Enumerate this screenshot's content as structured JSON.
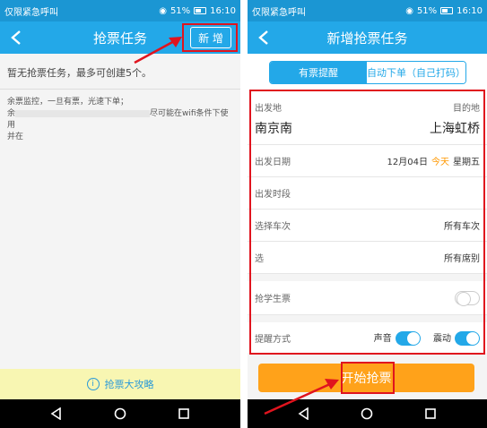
{
  "left": {
    "status": {
      "carrier": "仅限紧急呼叫",
      "battery": "51%",
      "time": "16:10"
    },
    "title": "抢票任务",
    "add_label": "新 增",
    "notice": "暂无抢票任务，最多可创建5个。",
    "monitor_line1": "余票监控，一旦有票，光速下单；",
    "monitor_line2_a": "余",
    "monitor_line2_b": "尽可能在wifi条件下使用",
    "monitor_line3": "并在",
    "guide_icon": "i",
    "guide_label": "抢票大攻略"
  },
  "right": {
    "status": {
      "carrier": "仅限紧急呼叫",
      "battery": "51%",
      "time": "16:10"
    },
    "title": "新增抢票任务",
    "tabs": [
      {
        "label": "有票提醒",
        "active": true
      },
      {
        "label": "自动下单（自己打码）",
        "active": false
      }
    ],
    "from_label": "出发地",
    "to_label": "目的地",
    "from_value": "南京南",
    "to_value": "上海虹桥",
    "date_label": "出发日期",
    "date_value": "12月04日",
    "today_label": "今天",
    "weekday_label": "星期五",
    "time_label": "出发时段",
    "train_label": "选择车次",
    "train_value": "所有车次",
    "seat_label": "选",
    "seat_value": "所有席别",
    "student_label": "抢学生票",
    "remind_label": "提醒方式",
    "sound_label": "声音",
    "vibrate_label": "震动",
    "start_label": "开始抢票"
  },
  "colors": {
    "accent": "#23a8e8",
    "start_button": "#ffa21a",
    "today": "#ff9800",
    "highlight": "#e0141e"
  }
}
